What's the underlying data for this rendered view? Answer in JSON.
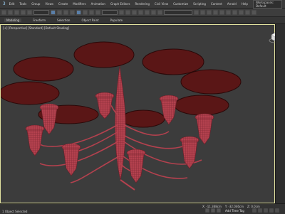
{
  "menu": {
    "items": [
      "Edit",
      "Tools",
      "Group",
      "Views",
      "Create",
      "Modifiers",
      "Animation",
      "Graph Editors",
      "Rendering",
      "Civil View",
      "Customize",
      "Scripting",
      "Content",
      "Arnold",
      "Help"
    ],
    "workspace": "Workspaces: Default"
  },
  "ribbon": {
    "tabs": [
      "Modeling",
      "Freeform",
      "Selection",
      "Object Paint",
      "Populate"
    ]
  },
  "viewport": {
    "label": "[+] [Perspective] [Standard] [Default Shading]",
    "mesh_color": "#b3414e",
    "disc_color": "#5a1616"
  },
  "status": {
    "left": "1 Object Selected",
    "coord_x": "X: -11.368cm",
    "coord_y": "Y: -32.046cm",
    "coord_z": "Z: 0.0cm",
    "time_tag": "Add Time Tag"
  },
  "icons": [
    "app-logo-icon",
    "viewcube-icon"
  ]
}
